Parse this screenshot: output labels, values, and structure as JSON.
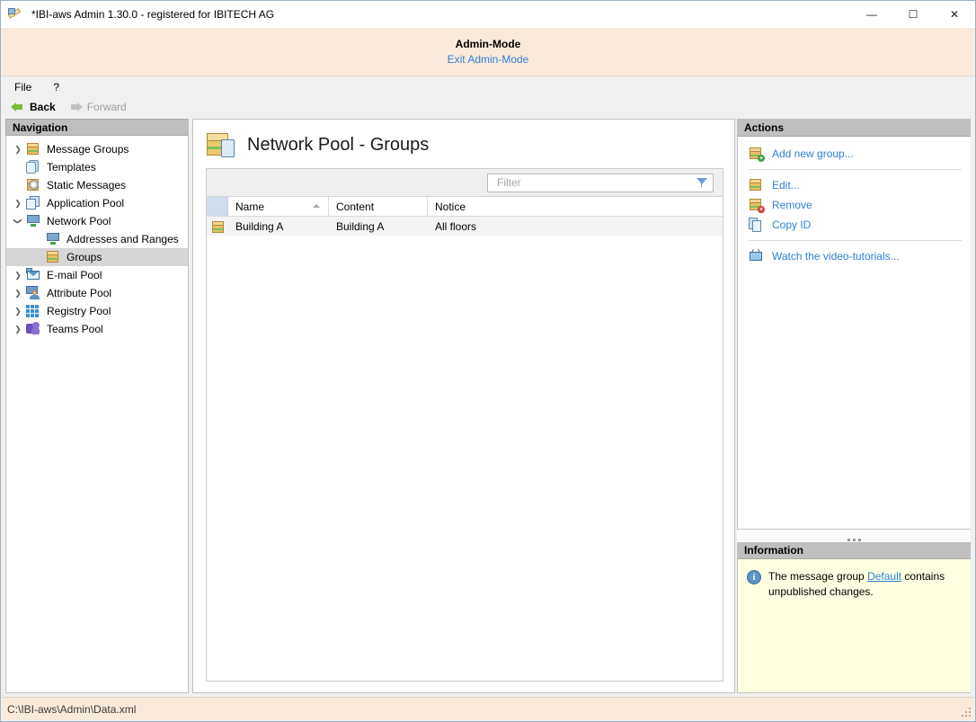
{
  "window": {
    "title": "*IBI-aws Admin 1.30.0 - registered for IBITECH AG",
    "icon": "pencil-icon",
    "minimize": "—",
    "maximize": "☐",
    "close": "✕"
  },
  "admin_banner": {
    "title": "Admin-Mode",
    "exit_link": "Exit Admin-Mode"
  },
  "menubar": {
    "items": [
      {
        "label": "File"
      },
      {
        "label": "?"
      }
    ]
  },
  "nav_toolbar": {
    "back": "Back",
    "forward": "Forward"
  },
  "navigation": {
    "header": "Navigation",
    "items": [
      {
        "label": "Message Groups",
        "icon": "gold-box-icon",
        "expander": "collapsed",
        "indent": 0,
        "selected": false
      },
      {
        "label": "Templates",
        "icon": "templates-icon",
        "expander": "none",
        "indent": 0,
        "selected": false
      },
      {
        "label": "Static Messages",
        "icon": "gear-box-icon",
        "expander": "none",
        "indent": 0,
        "selected": false
      },
      {
        "label": "Application Pool",
        "icon": "app-pool-icon",
        "expander": "collapsed",
        "indent": 0,
        "selected": false
      },
      {
        "label": "Network Pool",
        "icon": "monitor-icon",
        "expander": "expanded",
        "indent": 0,
        "selected": false
      },
      {
        "label": "Addresses and Ranges",
        "icon": "monitor-icon",
        "expander": "none",
        "indent": 1,
        "selected": false
      },
      {
        "label": "Groups",
        "icon": "gold-box-icon",
        "expander": "none",
        "indent": 1,
        "selected": true
      },
      {
        "label": "E-mail Pool",
        "icon": "envelope-icon",
        "expander": "collapsed",
        "indent": 0,
        "selected": false
      },
      {
        "label": "Attribute Pool",
        "icon": "attribute-icon",
        "expander": "collapsed",
        "indent": 0,
        "selected": false
      },
      {
        "label": "Registry Pool",
        "icon": "registry-grid-icon",
        "expander": "collapsed",
        "indent": 0,
        "selected": false
      },
      {
        "label": "Teams Pool",
        "icon": "teams-icon",
        "expander": "collapsed",
        "indent": 0,
        "selected": false
      }
    ]
  },
  "content": {
    "page_title": "Network Pool - Groups",
    "page_icon": "gold-box-document-icon",
    "filter": {
      "placeholder": "Filter",
      "value": ""
    },
    "table": {
      "columns": [
        "Name",
        "Content",
        "Notice"
      ],
      "sorted_column": "Name",
      "sort_direction": "ascending",
      "rows": [
        {
          "icon": "gold-box-icon",
          "name": "Building A",
          "content": "Building A",
          "notice": "All floors"
        }
      ]
    }
  },
  "actions": {
    "header": "Actions",
    "items": [
      {
        "label": "Add new group...",
        "icon": "gold-box-plus-icon",
        "separator_after": true
      },
      {
        "label": "Edit...",
        "icon": "gold-box-icon",
        "separator_after": false
      },
      {
        "label": "Remove",
        "icon": "gold-box-delete-icon",
        "separator_after": false
      },
      {
        "label": "Copy ID",
        "icon": "copy-pages-icon",
        "separator_after": true
      },
      {
        "label": "Watch the video-tutorials...",
        "icon": "tv-icon",
        "separator_after": false
      }
    ]
  },
  "information": {
    "header": "Information",
    "icon": "info-circle-icon",
    "text_before": "The message group ",
    "link": "Default",
    "text_after": " contains unpublished changes."
  },
  "statusbar": {
    "path": "C:\\IBI-aws\\Admin\\Data.xml"
  },
  "colors": {
    "admin_banner_bg": "#faeadb",
    "panel_header_bg": "#bfbfbf",
    "link": "#2e7fd4",
    "info_bg": "#ffffe1",
    "selection": "#d6d6d6"
  }
}
